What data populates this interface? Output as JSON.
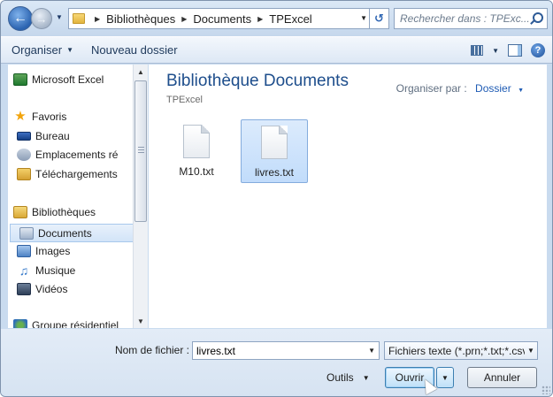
{
  "address": {
    "crumbs": [
      "Bibliothèques",
      "Documents",
      "TPExcel"
    ],
    "search_placeholder": "Rechercher dans : TPExc..."
  },
  "toolbar": {
    "organize": "Organiser",
    "new_folder": "Nouveau dossier"
  },
  "nav": {
    "items": [
      {
        "label": "Microsoft Excel"
      },
      {
        "label": "Favoris"
      },
      {
        "label": "Bureau"
      },
      {
        "label": "Emplacements ré"
      },
      {
        "label": "Téléchargements"
      },
      {
        "label": "Bibliothèques"
      },
      {
        "label": "Documents"
      },
      {
        "label": "Images"
      },
      {
        "label": "Musique"
      },
      {
        "label": "Vidéos"
      },
      {
        "label": "Groupe résidentiel"
      }
    ]
  },
  "content": {
    "title": "Bibliothèque Documents",
    "subtitle": "TPExcel",
    "arrange_label": "Organiser par :",
    "arrange_value": "Dossier",
    "files": [
      {
        "name": "M10.txt"
      },
      {
        "name": "livres.txt"
      }
    ]
  },
  "bottom": {
    "filename_label": "Nom de fichier :",
    "filename_value": "livres.txt",
    "filetype": "Fichiers texte (*.prn;*.txt;*.csv",
    "tools": "Outils",
    "open": "Ouvrir",
    "cancel": "Annuler"
  }
}
